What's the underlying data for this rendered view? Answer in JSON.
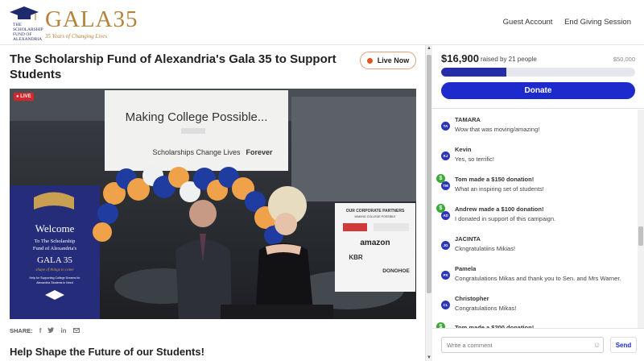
{
  "header": {
    "logo_org": "THE SCHOLARSHIP FUND OF ALEXANDRIA",
    "logo_gala": "GALA35",
    "logo_tagline": "35 Years of Changing Lives",
    "nav": [
      "Guest Account",
      "End Giving Session"
    ]
  },
  "event": {
    "title": "The Scholarship Fund of Alexandria's Gala 35 to Support Students",
    "live_button": "Live Now",
    "live_badge": "LIVE",
    "share_label": "SHARE:",
    "share_icons": [
      "facebook-icon",
      "twitter-icon",
      "linkedin-icon",
      "email-icon"
    ],
    "subheading": "Help Shape the Future of our Students!"
  },
  "video_scene": {
    "banner_line1": "Making College Possible...",
    "banner_line2": "Scholarships Change Lives",
    "banner_line3": "Forever",
    "welcome_title": "Welcome",
    "welcome_sub1": "To The Scholarship",
    "welcome_sub2": "Fund of Alexandria's",
    "welcome_gala": "GALA 35",
    "welcome_sub3": "shape of things to come",
    "welcome_sub4": "Help for Supporting College Dreams for",
    "welcome_sub5": "Alexandria Students in Need",
    "partners_title": "OUR CORPORATE PARTNERS",
    "partners_sub": "MAKING COLLEGE POSSIBLE",
    "partner_logos": [
      "amazon",
      "KBR",
      "DONOHOE"
    ]
  },
  "donation": {
    "amount": "$16,900",
    "raised_text": "raised by 21 people",
    "goal": "$50,000",
    "progress": 0.338,
    "donate_label": "Donate"
  },
  "chat": {
    "messages": [
      {
        "initials": "TA",
        "name": "TAMARA",
        "text": "Wow that was moving/amazing!",
        "donation": false
      },
      {
        "initials": "KJ",
        "name": "Kevin",
        "text": "Yes, so terrific!",
        "donation": false
      },
      {
        "initials": "TM",
        "name": "Tom made a $150 donation!",
        "text": "What an inspiring set of students!",
        "donation": true
      },
      {
        "initials": "AD",
        "name": "Andrew made a $100 donation!",
        "text": "I donated in support of this campaign.",
        "donation": true
      },
      {
        "initials": "JG",
        "name": "JACINTA",
        "text": "Ckngratulatiins Mikias!",
        "donation": false
      },
      {
        "initials": "PS",
        "name": "Pamela",
        "text": "Congratulations Mikas and thank you to Sen. and Mrs Warner.",
        "donation": false
      },
      {
        "initials": "CL",
        "name": "Christopher",
        "text": "Congratulations Mikas!",
        "donation": false
      },
      {
        "initials": "TM",
        "name": "Tom made a $200 donation!",
        "text": "",
        "donation": true
      }
    ],
    "comment_placeholder": "Write a comment",
    "send_label": "Send"
  },
  "colors": {
    "accent": "#1e2bcc",
    "progress_fill": "#252ea8",
    "live_dot": "#e0541e",
    "donation_badge": "#3aaa35",
    "logo_gold": "#b5823b"
  }
}
